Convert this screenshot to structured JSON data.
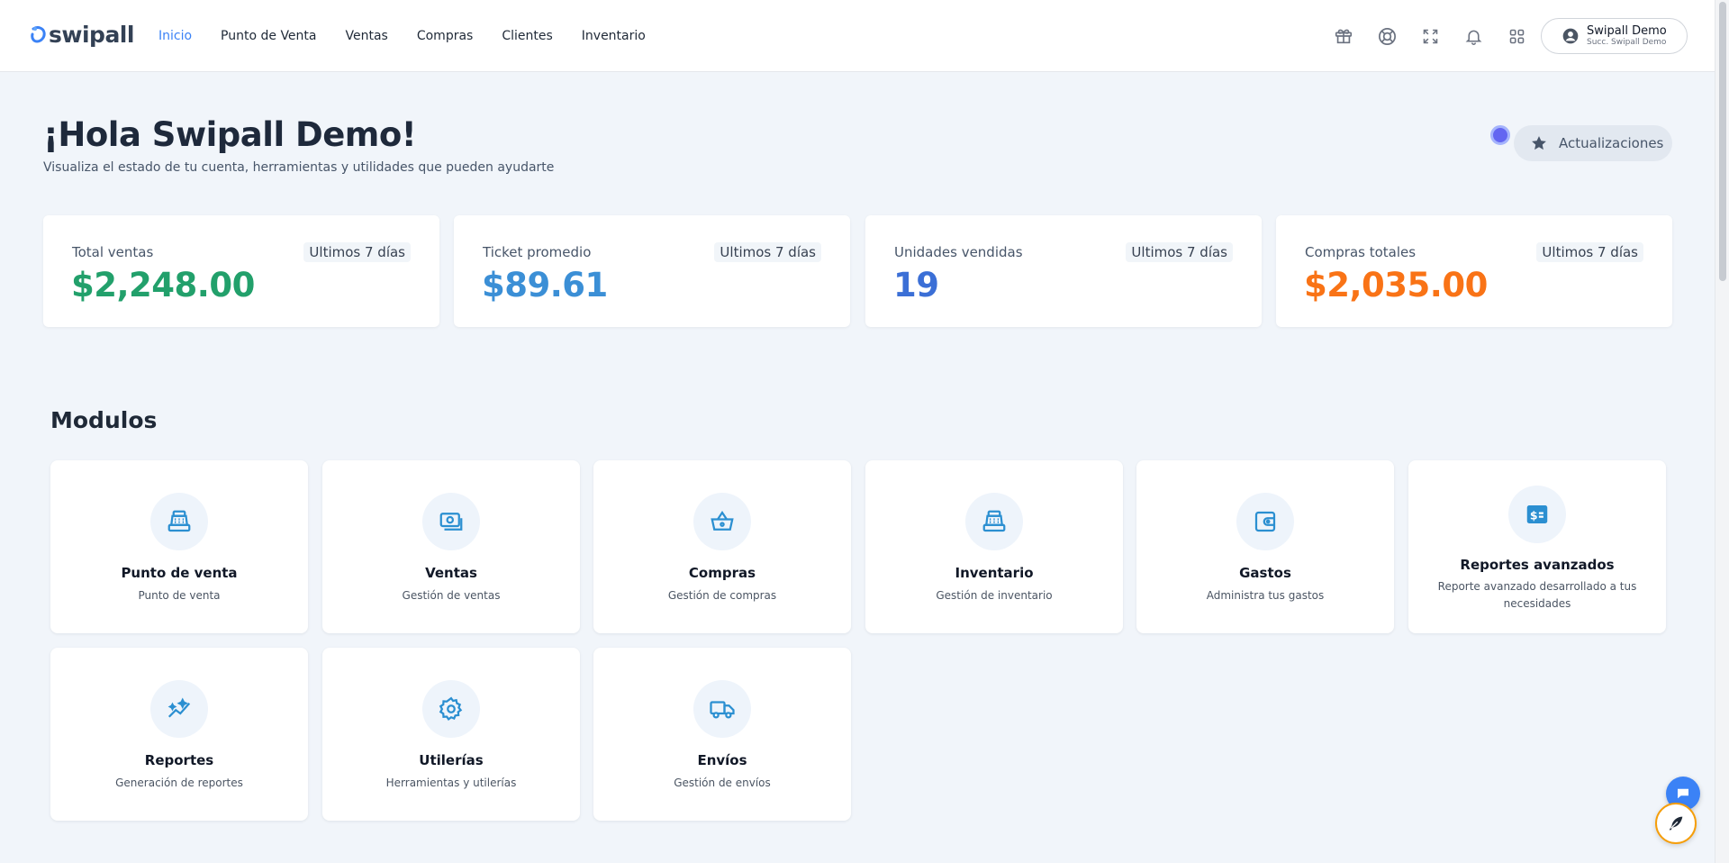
{
  "brand": {
    "logo_text": "swipall",
    "accent": "#3b82f6"
  },
  "nav": {
    "items": [
      "Inicio",
      "Punto de Venta",
      "Ventas",
      "Compras",
      "Clientes",
      "Inventario"
    ],
    "active": "Inicio"
  },
  "header_icons": [
    "gift-icon",
    "lifebuoy-icon",
    "fullscreen-icon",
    "bell-icon",
    "apps-grid-icon"
  ],
  "user": {
    "name": "Swipall Demo",
    "branch": "Succ. Swipall Demo"
  },
  "greeting": {
    "title": "¡Hola Swipall Demo!",
    "subtitle": "Visualiza el estado de tu cuenta, herramientas y utilidades que pueden ayudarte"
  },
  "updates_button": "Actualizaciones",
  "stats": [
    {
      "label": "Total ventas",
      "badge": "Ultimos 7 días",
      "value": "$2,248.00",
      "color": "#22a06b"
    },
    {
      "label": "Ticket promedio",
      "badge": "Ultimos 7 días",
      "value": "$89.61",
      "color": "#3b8fd6"
    },
    {
      "label": "Unidades vendidas",
      "badge": "Ultimos 7 días",
      "value": "19",
      "color": "#3b6fd6"
    },
    {
      "label": "Compras totales",
      "badge": "Ultimos 7 días",
      "value": "$2,035.00",
      "color": "#f97316"
    }
  ],
  "modules_title": "Modulos",
  "modules": [
    {
      "name": "Punto de venta",
      "desc": "Punto de venta",
      "icon": "cash-register-icon"
    },
    {
      "name": "Ventas",
      "desc": "Gestión de ventas",
      "icon": "money-bill-icon"
    },
    {
      "name": "Compras",
      "desc": "Gestión de compras",
      "icon": "basket-icon"
    },
    {
      "name": "Inventario",
      "desc": "Gestión de inventario",
      "icon": "cash-register-icon"
    },
    {
      "name": "Gastos",
      "desc": "Administra tus gastos",
      "icon": "wallet-icon"
    },
    {
      "name": "Reportes avanzados",
      "desc": "Reporte avanzado desarrollado a tus necesidades",
      "icon": "dollar-report-icon"
    },
    {
      "name": "Reportes",
      "desc": "Generación de reportes",
      "icon": "trend-chart-icon"
    },
    {
      "name": "Utilerías",
      "desc": "Herramientas y utilerías",
      "icon": "gear-icon"
    },
    {
      "name": "Envíos",
      "desc": "Gestión de envíos",
      "icon": "truck-icon"
    }
  ]
}
